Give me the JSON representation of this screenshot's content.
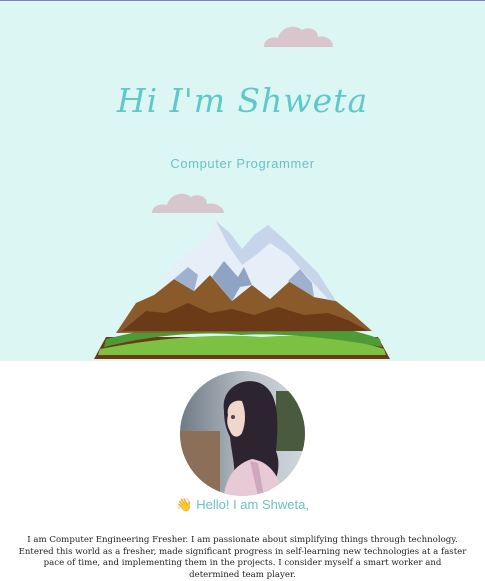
{
  "hero": {
    "title": "Hi I'm Shweta",
    "subtitle": "Computer   Programmer"
  },
  "colors": {
    "hero_background": "#dcf7f3",
    "accent_text": "#5ec9c9",
    "cloud": "#d8c6cc"
  },
  "icons": {
    "greeting": "waving-hand-icon",
    "cloud": "cloud-icon"
  },
  "profile": {
    "greeting_icon": "👋",
    "greeting": "Hello! I am Shweta,",
    "about": "I am Computer Engineering Fresher. I am passionate about simplifying things through technology. Entered this world as a fresher, made significant progress in self-learning new technologies at a faster pace of time, and implementing them in the projects. I consider myself a smart worker and determined team player."
  }
}
